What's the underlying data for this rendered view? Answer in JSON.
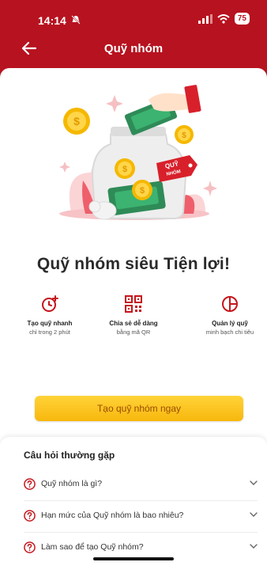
{
  "status_bar": {
    "time": "14:14",
    "battery": "75"
  },
  "header": {
    "title": "Quỹ nhóm"
  },
  "hero": {
    "tag_line1": "QUỸ",
    "tag_line2": "NHÓM"
  },
  "headline": "Quỹ nhóm siêu Tiện lợi!",
  "features": [
    {
      "icon": "clock-plus-icon",
      "title": "Tạo quỹ nhanh",
      "subtitle": "chỉ trong 2 phút"
    },
    {
      "icon": "qr-code-icon",
      "title": "Chia sẻ dễ dàng",
      "subtitle": "bằng mã QR"
    },
    {
      "icon": "pie-chart-icon",
      "title": "Quản lý quỹ",
      "subtitle": "minh bạch chi tiêu"
    }
  ],
  "cta": {
    "label": "Tạo quỹ nhóm ngay"
  },
  "faq": {
    "title": "Câu hỏi thường gặp",
    "items": [
      {
        "question": "Quỹ nhóm là gì?"
      },
      {
        "question": "Hạn mức của Quỹ nhóm là bao nhiêu?"
      },
      {
        "question": "Làm sao để tạo Quỹ nhóm?"
      }
    ]
  },
  "colors": {
    "brand_red": "#b7121f",
    "button_yellow": "#f8b70d",
    "button_text": "#9a4c00"
  }
}
